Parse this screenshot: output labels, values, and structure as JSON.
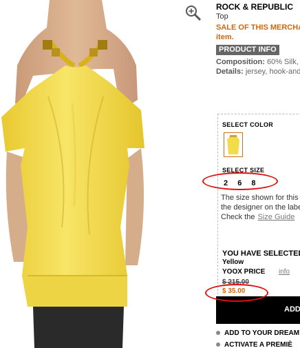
{
  "product": {
    "brand": "ROCK & REPUBLIC",
    "category": "Top",
    "sale_line1": "SALE OF THIS MERCHA",
    "sale_line2": "item.",
    "product_info_label": "PRODUCT INFO",
    "composition_label": "Composition:",
    "composition_value": "60% Silk,",
    "details_label": "Details:",
    "details_value": "jersey, hook-and"
  },
  "selection": {
    "select_color_label": "SELECT COLOR",
    "select_size_label": "SELECT SIZE",
    "sizes": [
      "2",
      "6",
      "8"
    ],
    "note_line1": "The size shown for this",
    "note_line2": "the designer on the labe",
    "check_the": "Check the",
    "size_guide_link": "Size Guide",
    "you_have_selected": "YOU HAVE SELECTED:",
    "selected_color": "Yellow",
    "yoox_price_label": "YOOX PRICE",
    "info_link": "info",
    "original_price": "$ 215.00",
    "sale_price": "$ 35.00"
  },
  "actions": {
    "add_button": "ADD",
    "add_dream": "ADD TO YOUR DREAM",
    "activate": "ACTIVATE A PREMIÈ"
  },
  "colors": {
    "sale_accent": "#d0680a",
    "annotation_red": "#e01010",
    "swatch_yellow": "#f3dc4a",
    "button_black": "#000000"
  },
  "icons": {
    "zoom": "magnifier-plus-icon",
    "bullet": "circle-bullet-icon"
  }
}
